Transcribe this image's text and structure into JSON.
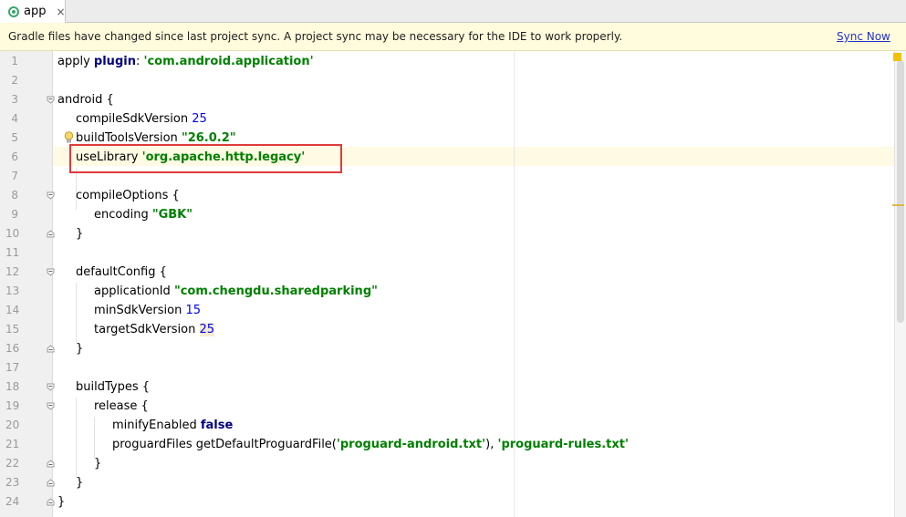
{
  "tab": {
    "label": "app",
    "close": "×"
  },
  "notification": {
    "message": "Gradle files have changed since last project sync. A project sync may be necessary for the IDE to work properly.",
    "action": "Sync Now"
  },
  "editor": {
    "line_numbers": [
      "1",
      "2",
      "3",
      "4",
      "5",
      "6",
      "7",
      "8",
      "9",
      "10",
      "11",
      "12",
      "13",
      "14",
      "15",
      "16",
      "17",
      "18",
      "19",
      "20",
      "21",
      "22",
      "23",
      "24"
    ],
    "lines": {
      "l1_a": "apply ",
      "l1_b": "plugin",
      "l1_c": ": ",
      "l1_d": "'com.android.application'",
      "l3": "android {",
      "l4_a": "compileSdkVersion ",
      "l4_b": "25",
      "l5_a": "buildToolsVersion ",
      "l5_b": "\"26.0.2\"",
      "l6_a": "useLibrary ",
      "l6_b": "'org.apache.http.legacy'",
      "l8": "compileOptions {",
      "l9_a": "encoding ",
      "l9_b": "\"GBK\"",
      "l10": "}",
      "l12": "defaultConfig {",
      "l13_a": "applicationId ",
      "l13_b": "\"com.chengdu.sharedparking\"",
      "l14_a": "minSdkVersion ",
      "l14_b": "15",
      "l15_a": "targetSdkVersion ",
      "l15_b": "25",
      "l16": "}",
      "l18": "buildTypes {",
      "l19": "release {",
      "l20_a": "minifyEnabled ",
      "l20_b": "false",
      "l21_a": "proguardFiles getDefaultProguardFile(",
      "l21_b": "'proguard-android.txt'",
      "l21_c": "), ",
      "l21_d": "'proguard-rules.txt'",
      "l22": "}",
      "l23": "}",
      "l24": "}"
    }
  },
  "colors": {
    "highlight_box": "#e03a3a",
    "string": "#008000",
    "number": "#0000ff",
    "keyword": "#000080"
  }
}
